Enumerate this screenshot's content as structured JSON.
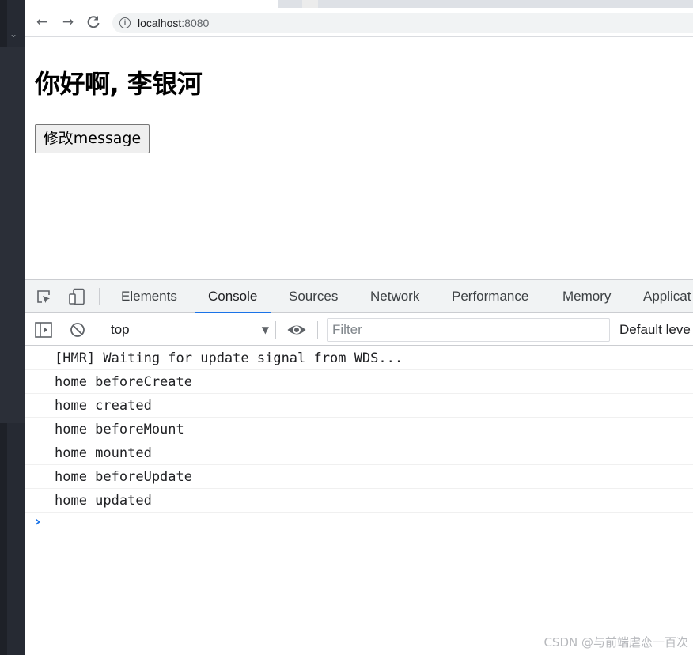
{
  "browser": {
    "url_host": "localhost",
    "url_port": ":8080"
  },
  "page": {
    "heading": "你好啊, 李银河",
    "button_label": "修改message"
  },
  "devtools": {
    "tabs": [
      "Elements",
      "Console",
      "Sources",
      "Network",
      "Performance",
      "Memory",
      "Applicat"
    ],
    "active_tab": "Console",
    "context_selector": "top",
    "filter_placeholder": "Filter",
    "levels_label": "Default leve",
    "console_lines": [
      "[HMR] Waiting for update signal from WDS...",
      "home beforeCreate",
      "home created",
      "home beforeMount",
      "home mounted",
      "home beforeUpdate",
      "home updated"
    ],
    "prompt_symbol": "›"
  },
  "watermark": "CSDN @与前端虐恋一百次",
  "colors": {
    "accent": "#1a73e8",
    "editor_sidebar": "#262a33"
  }
}
